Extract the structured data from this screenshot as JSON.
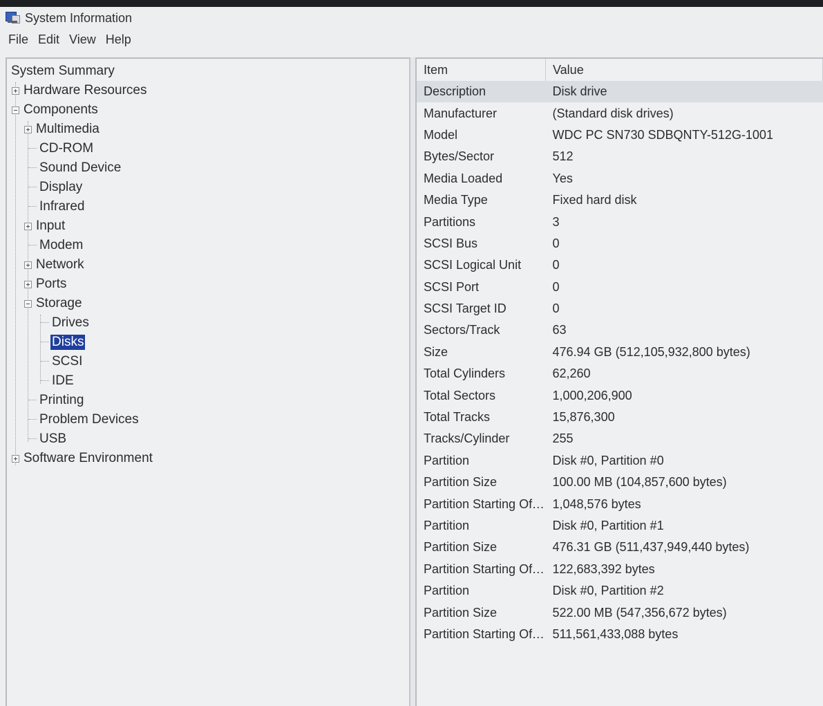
{
  "window": {
    "title": "System Information"
  },
  "menu": [
    "File",
    "Edit",
    "View",
    "Help"
  ],
  "tree": {
    "system_summary": "System Summary",
    "hardware_resources": "Hardware Resources",
    "components": "Components",
    "multimedia": "Multimedia",
    "cd_rom": "CD-ROM",
    "sound_device": "Sound Device",
    "display": "Display",
    "infrared": "Infrared",
    "input": "Input",
    "modem": "Modem",
    "network": "Network",
    "ports": "Ports",
    "storage": "Storage",
    "drives": "Drives",
    "disks": "Disks",
    "scsi": "SCSI",
    "ide": "IDE",
    "printing": "Printing",
    "problem_devices": "Problem Devices",
    "usb": "USB",
    "software_environment": "Software Environment",
    "selected": "Disks"
  },
  "details": {
    "columns": [
      "Item",
      "Value"
    ],
    "rows": [
      {
        "item": "Description",
        "value": "Disk drive"
      },
      {
        "item": "Manufacturer",
        "value": "(Standard disk drives)"
      },
      {
        "item": "Model",
        "value": "WDC PC SN730 SDBQNTY-512G-1001"
      },
      {
        "item": "Bytes/Sector",
        "value": "512"
      },
      {
        "item": "Media Loaded",
        "value": "Yes"
      },
      {
        "item": "Media Type",
        "value": "Fixed hard disk"
      },
      {
        "item": "Partitions",
        "value": "3"
      },
      {
        "item": "SCSI Bus",
        "value": "0"
      },
      {
        "item": "SCSI Logical Unit",
        "value": "0"
      },
      {
        "item": "SCSI Port",
        "value": "0"
      },
      {
        "item": "SCSI Target ID",
        "value": "0"
      },
      {
        "item": "Sectors/Track",
        "value": "63"
      },
      {
        "item": "Size",
        "value": "476.94 GB (512,105,932,800 bytes)"
      },
      {
        "item": "Total Cylinders",
        "value": "62,260"
      },
      {
        "item": "Total Sectors",
        "value": "1,000,206,900"
      },
      {
        "item": "Total Tracks",
        "value": "15,876,300"
      },
      {
        "item": "Tracks/Cylinder",
        "value": "255"
      },
      {
        "item": "Partition",
        "value": "Disk #0, Partition #0"
      },
      {
        "item": "Partition Size",
        "value": "100.00 MB (104,857,600 bytes)"
      },
      {
        "item": "Partition Starting Off...",
        "value": "1,048,576 bytes"
      },
      {
        "item": "Partition",
        "value": "Disk #0, Partition #1"
      },
      {
        "item": "Partition Size",
        "value": "476.31 GB (511,437,949,440 bytes)"
      },
      {
        "item": "Partition Starting Off...",
        "value": "122,683,392 bytes"
      },
      {
        "item": "Partition",
        "value": "Disk #0, Partition #2"
      },
      {
        "item": "Partition Size",
        "value": "522.00 MB (547,356,672 bytes)"
      },
      {
        "item": "Partition Starting Off...",
        "value": "511,561,433,088 bytes"
      }
    ]
  },
  "icons": {
    "app": "system-information-icon",
    "expand": "plus-box-icon",
    "collapse": "minus-box-icon"
  }
}
